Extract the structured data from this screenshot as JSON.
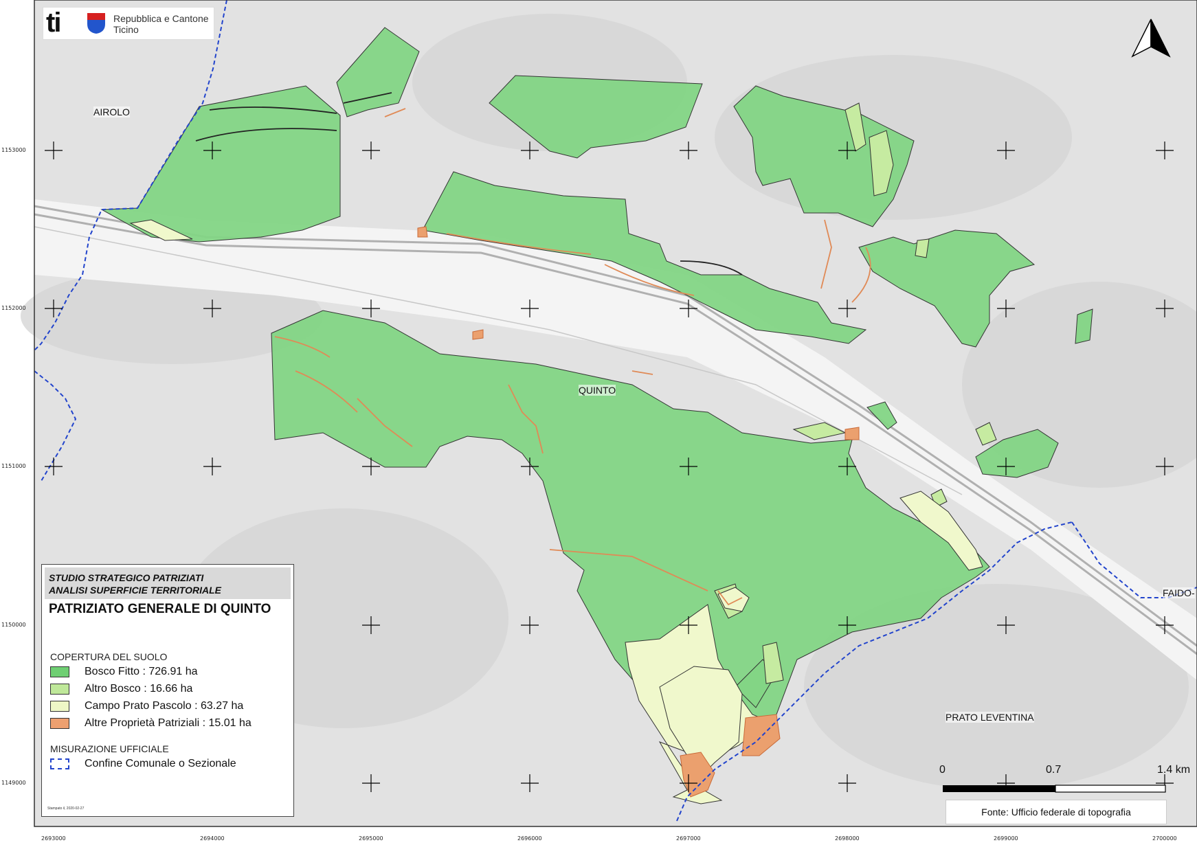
{
  "header": {
    "logo_short": "ti",
    "logo_line1": "Repubblica e Cantone",
    "logo_line2": "Ticino"
  },
  "places": {
    "airolo": "AIROLO",
    "quinto": "QUINTO",
    "faido": "FAIDO-",
    "prato": "PRATO LEVENTINA"
  },
  "legend": {
    "study_line1": "STUDIO STRATEGICO PATRIZIATI",
    "study_line2": "ANALISI SUPERFICIE TERRITORIALE",
    "title": "PATRIZIATO GENERALE DI QUINTO",
    "section_cover": "COPERTURA DEL SUOLO",
    "items": [
      {
        "label": "Bosco Fitto : 726.91 ha",
        "color": "#6fcf73"
      },
      {
        "label": "Altro Bosco : 16.66 ha",
        "color": "#bfe89a"
      },
      {
        "label": "Campo Prato Pascolo : 63.27 ha",
        "color": "#eef7c6"
      },
      {
        "label": "Altre Proprietà Patriziali : 15.01 ha",
        "color": "#eda070"
      }
    ],
    "section_measure": "MISURAZIONE UFFICIALE",
    "boundary_label": "Confine Comunale o Sezionale",
    "boundary_color": "#2244cc",
    "printed": "Stampato il, 2020-02-27"
  },
  "scale": {
    "s0": "0",
    "s1": "0.7",
    "s2": "1.4 km"
  },
  "source": "Fonte: Ufficio federale di topografia",
  "coords": {
    "y": [
      "1153000",
      "1152000",
      "1151000",
      "1150000",
      "1149000"
    ],
    "x": [
      "2693000",
      "2694000",
      "2695000",
      "2696000",
      "2697000",
      "2698000",
      "2699000",
      "2700000"
    ]
  }
}
